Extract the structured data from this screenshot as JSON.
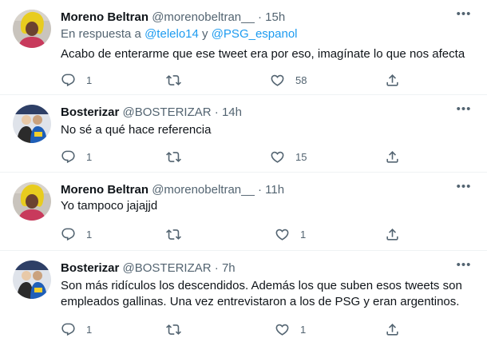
{
  "tweets": [
    {
      "name": "Moreno Beltran",
      "handle": "@morenobeltran__",
      "time": "15h",
      "reply_prefix": "En respuesta a",
      "reply_user1": "@telelo14",
      "reply_and": "y",
      "reply_user2": "@PSG_espanol",
      "text": "Acabo de enterarme que ese tweet era por eso, imagínate lo que nos afecta",
      "replies": "1",
      "retweets": "",
      "likes": "58"
    },
    {
      "name": "Bosterizar",
      "handle": "@BOSTERIZAR",
      "time": "14h",
      "text": "No sé a qué hace referencia",
      "replies": "1",
      "retweets": "",
      "likes": "15"
    },
    {
      "name": "Moreno Beltran",
      "handle": "@morenobeltran__",
      "time": "11h",
      "text": "Yo tampoco jajajjd",
      "replies": "1",
      "retweets": "",
      "likes": "1"
    },
    {
      "name": "Bosterizar",
      "handle": "@BOSTERIZAR",
      "time": "7h",
      "text": "Son más ridículos los descendidos. Además los que suben esos tweets son empleados gallinas. Una vez entrevistaron a los de PSG y eran argentinos.",
      "replies": "1",
      "retweets": "",
      "likes": "1"
    }
  ],
  "separator": "·",
  "colors": {
    "link": "#1d9bf0",
    "secondary": "#536471",
    "text": "#0f1419"
  }
}
